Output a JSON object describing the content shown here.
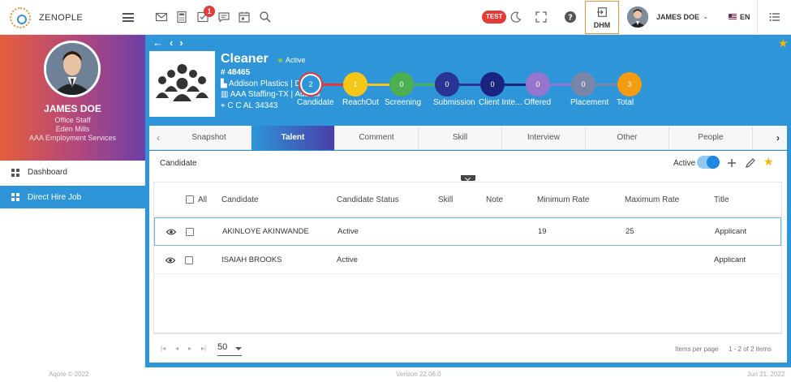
{
  "app": {
    "name": "ZENOPLE"
  },
  "topbar": {
    "notification_count": "1",
    "env_badge": "TEST",
    "dhm_label": "DHM",
    "user_name": "JAMES DOE",
    "language": "EN"
  },
  "sidebar": {
    "profile": {
      "name": "JAMES DOE",
      "role": "Office Staff",
      "location": "Eden Mills",
      "company": "AAA Employment Services"
    },
    "items": [
      {
        "label": "Dashboard"
      },
      {
        "label": "Direct Hire Job"
      }
    ]
  },
  "job": {
    "title": "Cleaner",
    "status": "Active",
    "number": "# 48465",
    "company": "Addison Plastics | DPT",
    "branch": "AAA Staffing-TX | Adams",
    "address": "C C AL 34343"
  },
  "pipeline": [
    {
      "label": "Candidate",
      "count": "2",
      "color": "#2d95d8",
      "border": "#e53935"
    },
    {
      "label": "ReachOut",
      "count": "1",
      "color": "#f5c518",
      "border": "#f5c518"
    },
    {
      "label": "Screening",
      "count": "0",
      "color": "#4caf50",
      "border": "#4caf50"
    },
    {
      "label": "Submission",
      "count": "0",
      "color": "#283593",
      "border": "#283593"
    },
    {
      "label": "Client Inte...",
      "count": "0",
      "color": "#1a237e",
      "border": "#1a237e"
    },
    {
      "label": "Offered",
      "count": "0",
      "color": "#9575cd",
      "border": "#9575cd"
    },
    {
      "label": "Placement",
      "count": "0",
      "color": "#7986a8",
      "border": "#7986a8"
    },
    {
      "label": "Total",
      "count": "3",
      "color": "#f39c12",
      "border": "#f39c12"
    }
  ],
  "tabs": [
    {
      "label": "Snapshot"
    },
    {
      "label": "Talent"
    },
    {
      "label": "Comment"
    },
    {
      "label": "Skill"
    },
    {
      "label": "Interview"
    },
    {
      "label": "Other"
    },
    {
      "label": "People"
    }
  ],
  "active_tab": "Talent",
  "panel": {
    "title": "Candidate",
    "active_label": "Active"
  },
  "table": {
    "select_all_label": "All",
    "columns": [
      "Candidate",
      "Candidate Status",
      "Skill",
      "Note",
      "Minimum Rate",
      "Maximum Rate",
      "Title"
    ],
    "rows": [
      {
        "candidate": "AKINLOYE AKINWANDE",
        "status": "Active",
        "skill": "",
        "note": "",
        "min_rate": "19",
        "max_rate": "25",
        "title": "Applicant"
      },
      {
        "candidate": "ISAIAH BROOKS",
        "status": "Active",
        "skill": "",
        "note": "",
        "min_rate": "",
        "max_rate": "",
        "title": "Applicant"
      }
    ]
  },
  "pager": {
    "page_size": "50",
    "items_per_page_label": "Items per page",
    "range": "1 - 2 of 2 items"
  },
  "footer": {
    "copyright": "Aqore © 2022",
    "version": "Version 22.06.0",
    "date": "Jun 21, 2022"
  }
}
